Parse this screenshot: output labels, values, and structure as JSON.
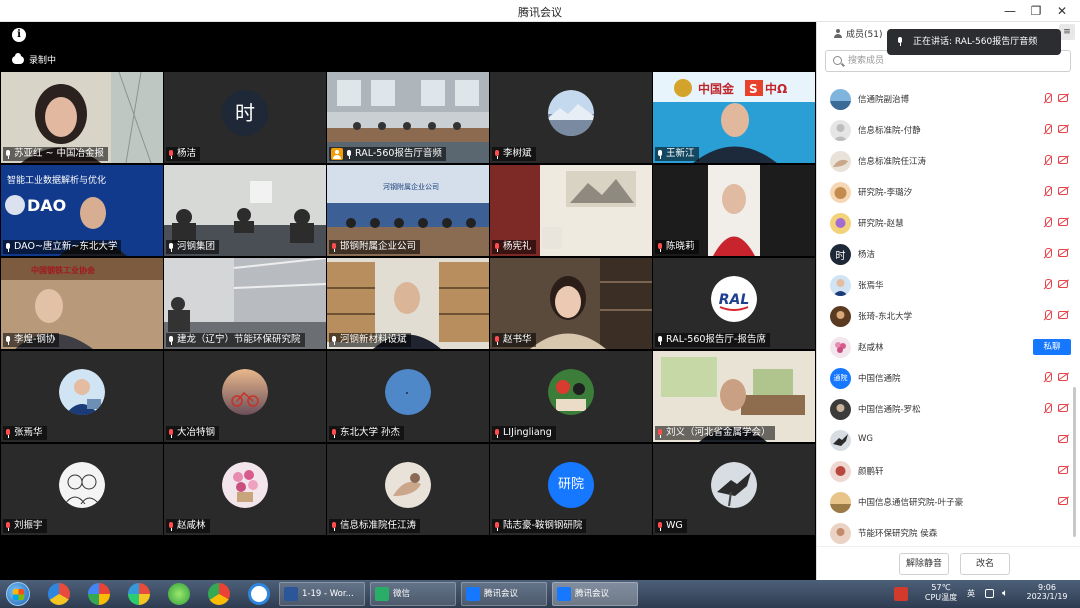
{
  "window": {
    "title": "腾讯会议"
  },
  "recording": {
    "label": "录制中"
  },
  "tiles": [
    {
      "label": "苏亚红 ~ 中国冶金报"
    },
    {
      "label": "杨洁"
    },
    {
      "label": "RAL-560报告厅音频"
    },
    {
      "label": "李树斌"
    },
    {
      "label": "王新江"
    },
    {
      "label": "DAO~唐立新~东北大学"
    },
    {
      "label": "河钢集团"
    },
    {
      "label": "邯钢附属企业公司"
    },
    {
      "label": "杨宪礼"
    },
    {
      "label": "陈晓莉"
    },
    {
      "label": "李煌-钢协"
    },
    {
      "label": "建龙（辽宁）节能环保研究院"
    },
    {
      "label": "河钢新材料设斌"
    },
    {
      "label": "赵书华"
    },
    {
      "label": "RAL-560报告厅-报告席"
    },
    {
      "label": "张焉华"
    },
    {
      "label": "大冶特钢"
    },
    {
      "label": "东北大学 孙杰"
    },
    {
      "label": "LIJingliang"
    },
    {
      "label": "刘义（河北省金属学会）"
    },
    {
      "label": "刘振宇"
    },
    {
      "label": "赵咸林"
    },
    {
      "label": "信息标准院任江涛"
    },
    {
      "label": "陆志豪-鞍钢钢研院"
    },
    {
      "label": "WG"
    }
  ],
  "tile_texts": {
    "shi": "时",
    "dao": "DAO",
    "dao_banner": "智能工业数据解析与优化",
    "yanyuan": "研院",
    "ral": "RAL",
    "cn_brand": "中国金",
    "cn_brand_s": "S",
    "cn_brand_right": "中Ω",
    "assoc": "中国钢铁工业协会",
    "hbg": "河钢附属企业公司"
  },
  "panel": {
    "members_label": "成员(51)",
    "speaking_text": "正在讲话: RAL-560报告厅音频",
    "search_placeholder": "搜索成员",
    "members": [
      {
        "name": "信通院副治博",
        "kind": "mic"
      },
      {
        "name": "信息标准院-付静",
        "kind": "mic"
      },
      {
        "name": "信息标准院任江涛",
        "kind": "mic"
      },
      {
        "name": "研究院-李璐汐",
        "kind": "mic"
      },
      {
        "name": "研究院-赵慧",
        "kind": "mic"
      },
      {
        "name": "杨洁",
        "kind": "mic"
      },
      {
        "name": "张焉华",
        "kind": "mic"
      },
      {
        "name": "张琦-东北大学",
        "kind": "mic"
      },
      {
        "name": "赵咸林",
        "kind": "chat"
      },
      {
        "name": "中国信通院",
        "kind": "mic"
      },
      {
        "name": "中国信通院-罗松",
        "kind": "mic"
      },
      {
        "name": "WG",
        "kind": "cam"
      },
      {
        "name": "颜鹏轩",
        "kind": "cam"
      },
      {
        "name": "中国信息通信研究院-叶子豪",
        "kind": "cam"
      },
      {
        "name": "节能环保研究院 侯森",
        "kind": "none"
      }
    ],
    "chat_label": "私聊",
    "avatar_text_cntong": "通院",
    "avatar_text_shi": "时",
    "unmute_all": "解除静音",
    "rename": "改名"
  },
  "taskbar": {
    "apps": [
      {
        "label": "1-19 - Wor..."
      },
      {
        "label": "微信"
      },
      {
        "label": "腾讯会议"
      },
      {
        "label": "腾讯会议"
      }
    ],
    "temp": "57℃",
    "temp_label": "CPU温度",
    "lang": "英",
    "time": "9:06",
    "date": "2023/1/19"
  },
  "colors": {
    "accent": "#1677ff",
    "active_speaker": "#22c55e",
    "muted": "#e6424a",
    "host_badge": "#f59e0b"
  }
}
